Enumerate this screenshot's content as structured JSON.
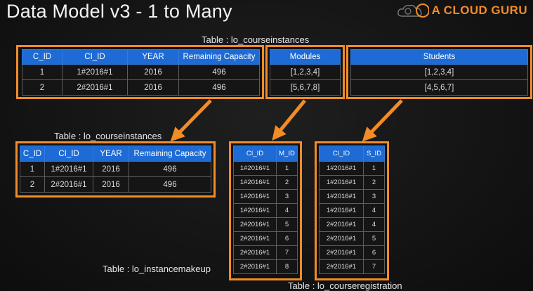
{
  "slide": {
    "title": "Data Model v3 - 1 to Many"
  },
  "brand": {
    "name": "A CLOUD GURU",
    "accent": "#f28c28"
  },
  "colors": {
    "header": "#1e6bd6",
    "outline": "#f28c28",
    "background": "#141414"
  },
  "captions": {
    "top_table": "Table : lo_courseinstances",
    "left_table": "Table : lo_courseinstances",
    "makeup_table": "Table : lo_instancemakeup",
    "registration_table": "Table : lo_courseregistration"
  },
  "top_table": {
    "main_headers": [
      "C_ID",
      "CI_ID",
      "YEAR",
      "Remaining Capacity"
    ],
    "modules_header": "Modules",
    "students_header": "Students",
    "rows": [
      {
        "cells": [
          "1",
          "1#2016#1",
          "2016",
          "496"
        ],
        "modules": "[1,2,3,4]",
        "students": "[1,2,3,4]"
      },
      {
        "cells": [
          "2",
          "2#2016#1",
          "2016",
          "496"
        ],
        "modules": "[5,6,7,8]",
        "students": "[4,5,6,7]"
      }
    ]
  },
  "left_table": {
    "headers": [
      "C_ID",
      "CI_ID",
      "YEAR",
      "Remaining Capacity"
    ],
    "rows": [
      [
        "1",
        "1#2016#1",
        "2016",
        "496"
      ],
      [
        "2",
        "2#2016#1",
        "2016",
        "496"
      ]
    ]
  },
  "makeup_table": {
    "headers": [
      "CI_ID",
      "M_ID"
    ],
    "rows": [
      [
        "1#2016#1",
        "1"
      ],
      [
        "1#2016#1",
        "2"
      ],
      [
        "1#2016#1",
        "3"
      ],
      [
        "1#2016#1",
        "4"
      ],
      [
        "2#2016#1",
        "5"
      ],
      [
        "2#2016#1",
        "6"
      ],
      [
        "2#2016#1",
        "7"
      ],
      [
        "2#2016#1",
        "8"
      ]
    ]
  },
  "registration_table": {
    "headers": [
      "CI_ID",
      "S_ID"
    ],
    "rows": [
      [
        "1#2016#1",
        "1"
      ],
      [
        "1#2016#1",
        "2"
      ],
      [
        "1#2016#1",
        "3"
      ],
      [
        "1#2016#1",
        "4"
      ],
      [
        "2#2016#1",
        "4"
      ],
      [
        "2#2016#1",
        "5"
      ],
      [
        "2#2016#1",
        "6"
      ],
      [
        "2#2016#1",
        "7"
      ]
    ]
  }
}
